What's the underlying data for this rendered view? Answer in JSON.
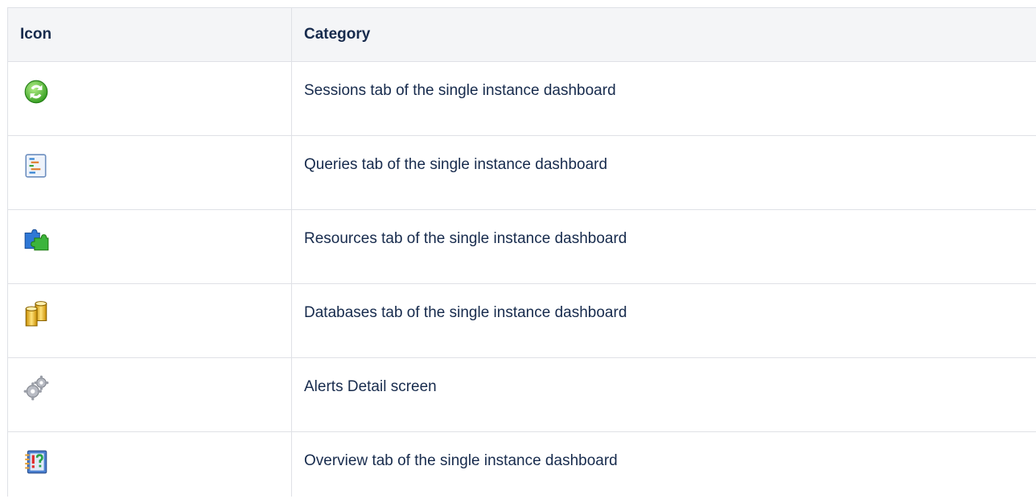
{
  "table": {
    "headers": {
      "icon": "Icon",
      "category": "Category"
    },
    "rows": [
      {
        "icon": "sessions-recycle-icon",
        "category": "Sessions tab of the single instance dashboard"
      },
      {
        "icon": "queries-document-icon",
        "category": "Queries tab of the single instance dashboard"
      },
      {
        "icon": "resources-puzzle-icon",
        "category": "Resources tab of the single instance dashboard"
      },
      {
        "icon": "databases-cylinder-icon",
        "category": "Databases tab of the single instance dashboard"
      },
      {
        "icon": "alerts-gears-icon",
        "category": "Alerts Detail screen"
      },
      {
        "icon": "overview-notebook-icon",
        "category": "Overview tab of the single instance dashboard"
      }
    ]
  }
}
